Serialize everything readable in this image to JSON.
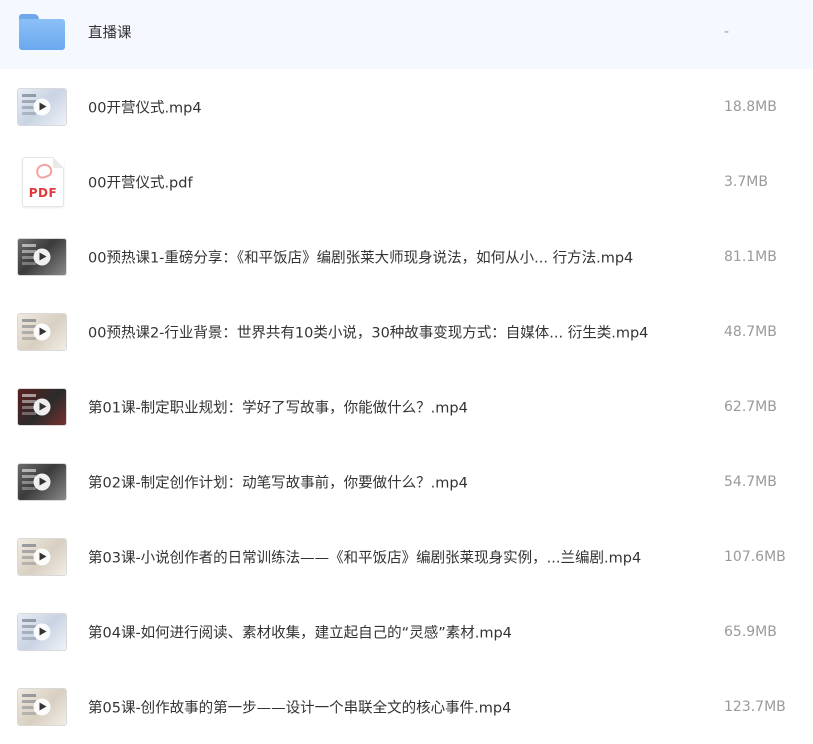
{
  "files": [
    {
      "type": "folder",
      "icon": "folder-icon",
      "name": "直播课",
      "size": "-"
    },
    {
      "type": "video",
      "icon": "video-thumbnail-icon",
      "theme": "light",
      "name": "00开营仪式.mp4",
      "size": "18.8MB"
    },
    {
      "type": "pdf",
      "icon": "pdf-icon",
      "icon_text": "PDF",
      "name": "00开营仪式.pdf",
      "size": "3.7MB"
    },
    {
      "type": "video",
      "icon": "video-thumbnail-icon",
      "theme": "dark",
      "name": "00预热课1-重磅分享：《和平饭店》编剧张莱大师现身说法，如何从小...  行方法.mp4",
      "size": "81.1MB"
    },
    {
      "type": "video",
      "icon": "video-thumbnail-icon",
      "theme": "beige",
      "name": "00预热课2-行业背景：世界共有10类小说，30种故事变现方式：自媒体...  衍生类.mp4",
      "size": "48.7MB"
    },
    {
      "type": "video",
      "icon": "video-thumbnail-icon",
      "theme": "red",
      "name": "第01课-制定职业规划：学好了写故事，你能做什么？.mp4",
      "size": "62.7MB"
    },
    {
      "type": "video",
      "icon": "video-thumbnail-icon",
      "theme": "dark",
      "name": "第02课-制定创作计划：动笔写故事前，你要做什么？.mp4",
      "size": "54.7MB"
    },
    {
      "type": "video",
      "icon": "video-thumbnail-icon",
      "theme": "beige",
      "name": "第03课-小说创作者的日常训练法——《和平饭店》编剧张莱现身实例，...兰编剧.mp4",
      "size": "107.6MB"
    },
    {
      "type": "video",
      "icon": "video-thumbnail-icon",
      "theme": "light",
      "name": "第04课-如何进行阅读、素材收集，建立起自己的“灵感”素材.mp4",
      "size": "65.9MB"
    },
    {
      "type": "video",
      "icon": "video-thumbnail-icon",
      "theme": "beige",
      "name": "第05课-创作故事的第一步——设计一个串联全文的核心事件.mp4",
      "size": "123.7MB"
    }
  ]
}
